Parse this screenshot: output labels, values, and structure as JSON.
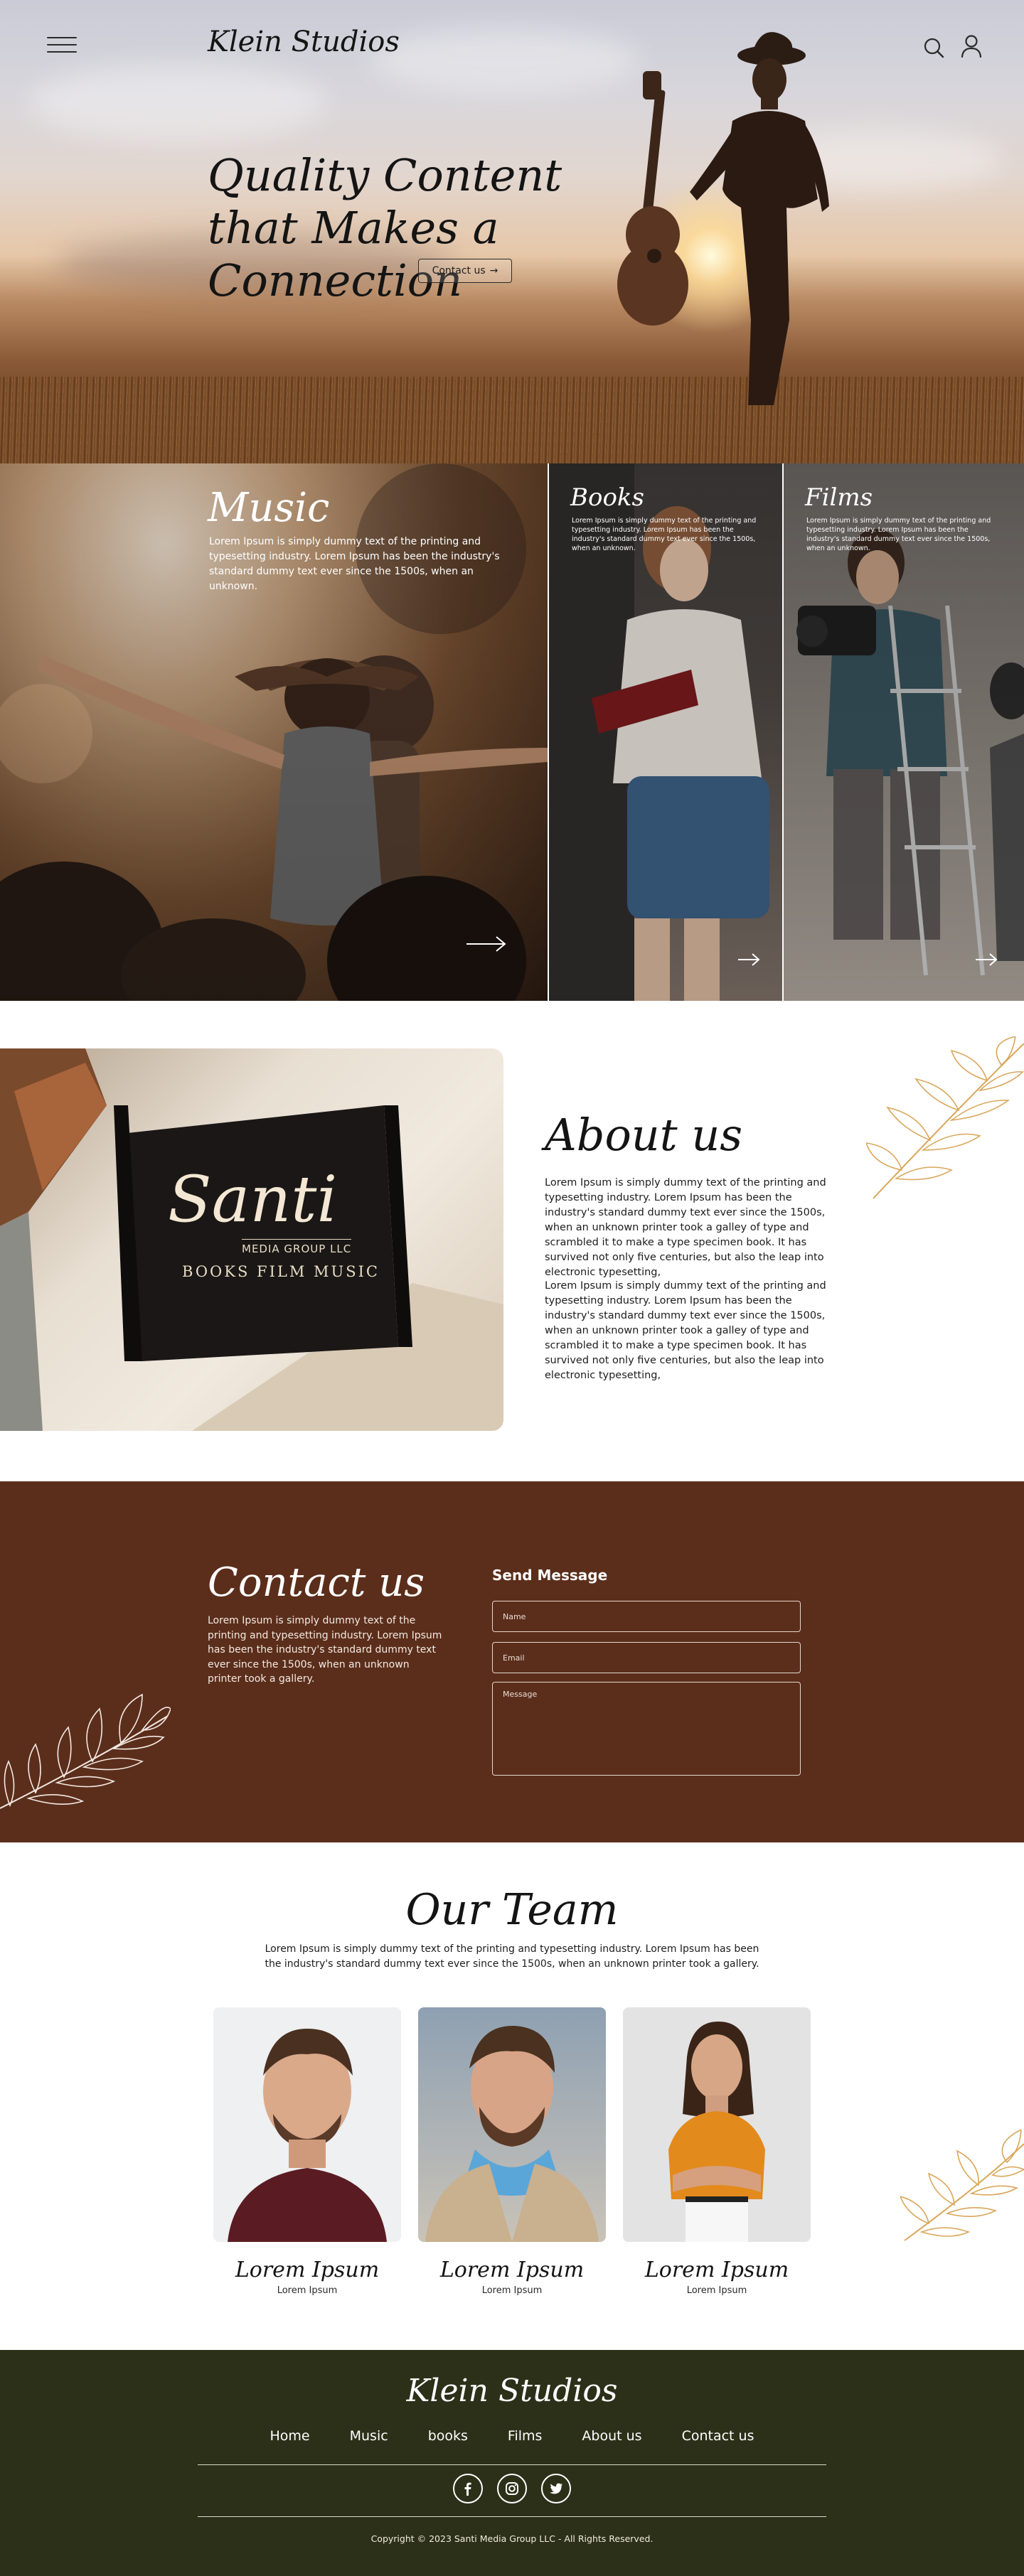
{
  "header": {
    "logo": "Klein Studios",
    "menu_icon": "hamburger-menu-icon",
    "search_icon": "search-icon",
    "user_icon": "user-icon"
  },
  "hero": {
    "title": "Quality Content that Makes a Connection",
    "cta_label": "Contact us",
    "cta_icon": "arrow-right-icon"
  },
  "categories": [
    {
      "title": "Music",
      "description": "Lorem Ipsum is simply dummy text of the printing and typesetting industry. Lorem Ipsum has been the industry's standard dummy text ever since the 1500s, when an unknown.",
      "icon": "arrow-right-icon"
    },
    {
      "title": "Books",
      "description": "Lorem Ipsum is simply dummy text of the printing and typesetting industry. Lorem Ipsum has been the industry's standard dummy text ever since the 1500s, when an unknown.",
      "icon": "arrow-right-icon"
    },
    {
      "title": "Films",
      "description": "Lorem Ipsum is simply dummy text of the printing and typesetting industry. Lorem Ipsum has been the industry's standard dummy text ever since the 1500s, when an unknown.",
      "icon": "arrow-right-icon"
    }
  ],
  "about": {
    "sign_name": "Santi",
    "sign_sub": "MEDIA GROUP LLC",
    "sign_tag": "BOOKS FILM MUSIC",
    "title": "About us",
    "p1": "Lorem Ipsum is simply dummy text of the printing and typesetting industry. Lorem Ipsum has been the industry's standard dummy text ever since the 1500s, when an unknown printer took a galley of type and scrambled it to make a type specimen book. It has survived not only five centuries, but also the leap into electronic typesetting,",
    "p2": "Lorem Ipsum is simply dummy text of the printing and typesetting industry. Lorem Ipsum has been the industry's standard dummy text ever since the 1500s, when an unknown printer took a galley of type and scrambled it to make a type specimen book. It has survived not only five centuries, but also the leap into electronic typesetting,"
  },
  "contact": {
    "title": "Contact us",
    "text": "Lorem Ipsum is simply dummy text of the printing and typesetting industry. Lorem Ipsum has been the industry's standard dummy text ever since the 1500s, when an unknown printer took a gallery.",
    "form_title": "Send Message",
    "name_placeholder": "Name",
    "email_placeholder": "Email",
    "message_placeholder": "Message"
  },
  "team": {
    "title": "Our Team",
    "text": "Lorem Ipsum is simply dummy text of the printing and typesetting industry. Lorem Ipsum has been the industry's standard dummy text ever since the 1500s, when an unknown printer took a gallery.",
    "members": [
      {
        "name": "Lorem Ipsum",
        "role": "Lorem Ipsum"
      },
      {
        "name": "Lorem Ipsum",
        "role": "Lorem Ipsum"
      },
      {
        "name": "Lorem Ipsum",
        "role": "Lorem Ipsum"
      }
    ]
  },
  "footer": {
    "logo": "Klein Studios",
    "nav": [
      "Home",
      "Music",
      "books",
      "Films",
      "About us",
      "Contact us"
    ],
    "socials": [
      "facebook-icon",
      "instagram-icon",
      "twitter-icon"
    ],
    "copyright": "Copyright © 2023 Santi Media Group LLC - All Rights Reserved."
  },
  "colors": {
    "contact_bg": "#5b2e1b",
    "footer_bg": "#2d3019",
    "leaf_accent": "#d9a65a"
  }
}
